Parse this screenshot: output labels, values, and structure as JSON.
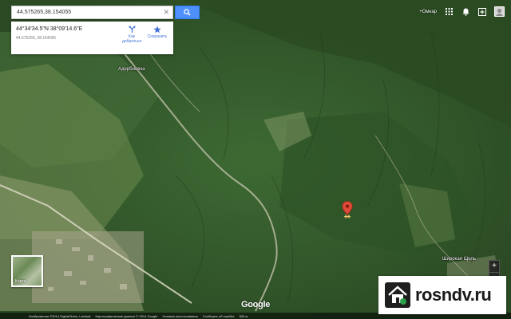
{
  "search": {
    "value": "44.575265,38.154055"
  },
  "info_card": {
    "coords_dms": "44°34'34.5\"N 38°09'14.6\"E",
    "coords_decimal": "44.575265, 38.154055",
    "directions_label": "Как добраться",
    "save_label": "Сохранить"
  },
  "top_bar": {
    "user_label": "+Омкар"
  },
  "places": {
    "village_top": "Адербиевка",
    "village_bottom_right": "Широкая Щель"
  },
  "earth": {
    "label": "Карта"
  },
  "logo": "Google",
  "footer": {
    "imagery": "Изображения ©2014 DigitalGlobe, Landsat",
    "map_data": "Картографические данные © 2014 Google",
    "terms": "Условия использования",
    "report": "Сообщить об ошибке",
    "scale": "500 м"
  },
  "zoom": {
    "in": "+",
    "out": "−"
  },
  "watermark": {
    "text": "rosndv.ru"
  },
  "colors": {
    "accent": "#4d90fe",
    "pin": "#dd4b39",
    "link": "#4274d6"
  }
}
